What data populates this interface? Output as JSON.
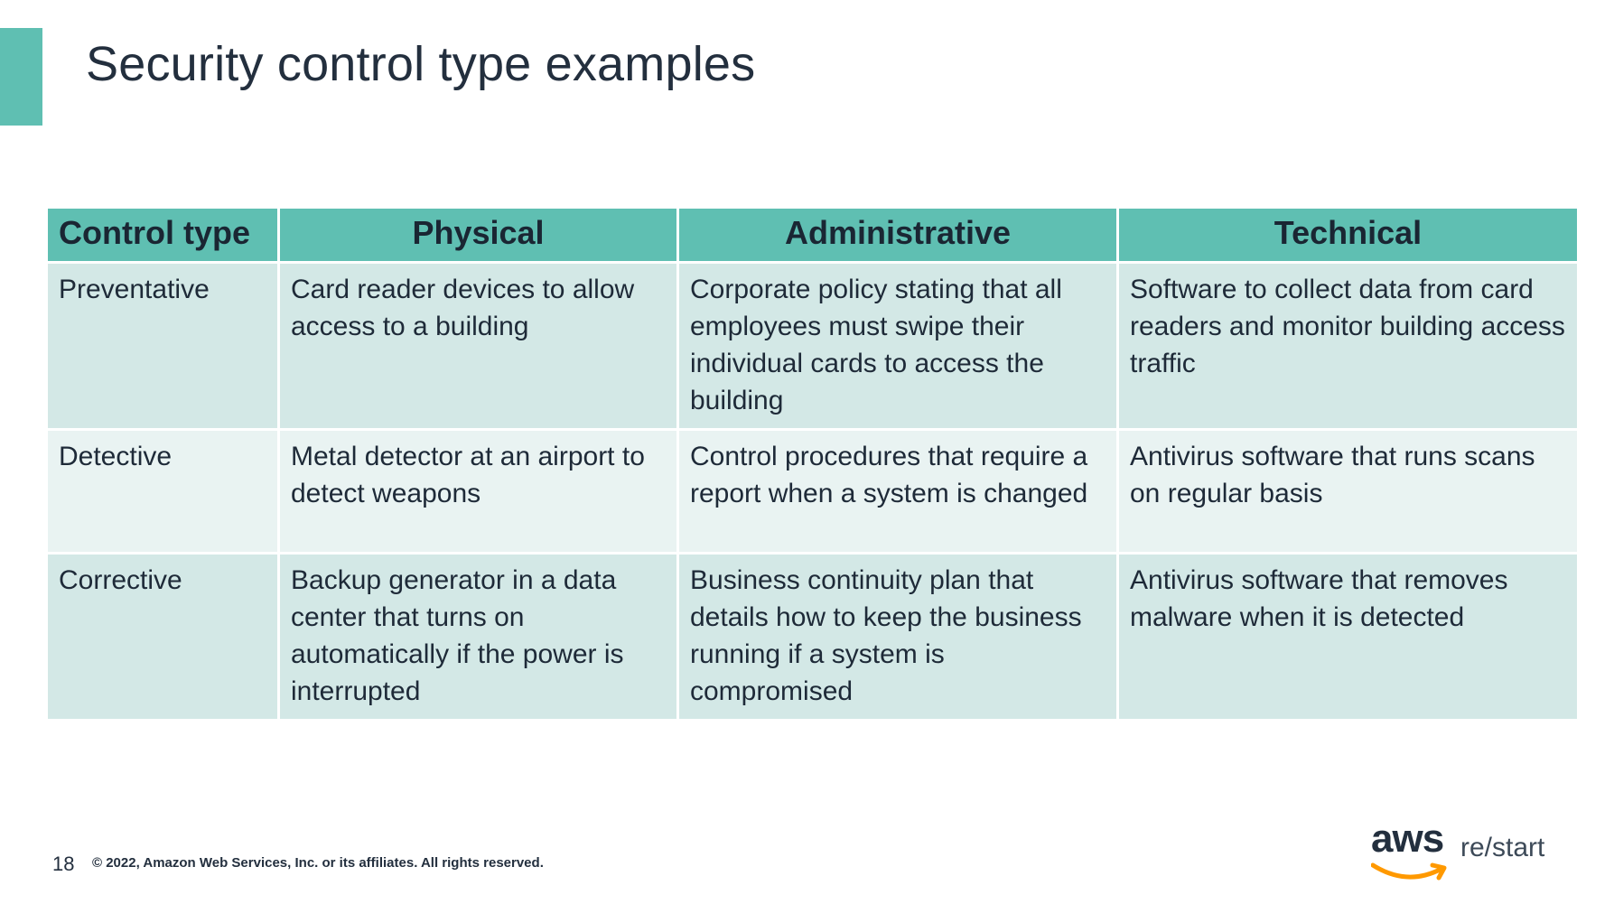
{
  "slide": {
    "title": "Security control type examples",
    "page_number": "18",
    "copyright": "© 2022, Amazon Web Services, Inc. or its affiliates. All rights reserved.",
    "accent_color": "#5fbfb2"
  },
  "table": {
    "headers": [
      "Control type",
      "Physical",
      "Administrative",
      "Technical"
    ],
    "rows": [
      [
        "Preventative",
        "Card reader devices to allow access to a building",
        "Corporate policy stating that all employees must swipe their individual cards to access the building",
        "Software to collect data from card readers and monitor building access traffic"
      ],
      [
        "Detective",
        "Metal detector at an airport to detect weapons",
        "Control procedures that require a report when a system is changed",
        "Antivirus software that runs scans on regular basis"
      ],
      [
        "Corrective",
        "Backup generator in a data center that turns on automatically if the power is interrupted",
        "Business continuity plan that details how to keep the business running if a system is compromised",
        "Antivirus software that removes malware when it is detected"
      ]
    ]
  },
  "brand": {
    "logo_text": "aws",
    "tagline": "re/start",
    "smile_color": "#ff9900"
  }
}
